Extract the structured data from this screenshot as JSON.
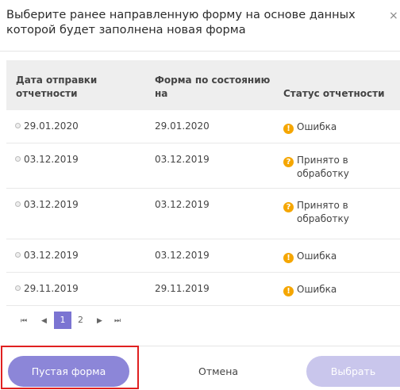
{
  "dialog": {
    "title": "Выберите ранее направленную форму на основе данных которой будет заполнена новая форма",
    "close_glyph": "×"
  },
  "table": {
    "headers": [
      "Дата отправки отчетности",
      "Форма по состоянию на",
      "Статус отчетности"
    ],
    "rows": [
      {
        "sent": "29.01.2020",
        "form_date": "29.01.2020",
        "status": "Ошибка",
        "icon": "!"
      },
      {
        "sent": "03.12.2019",
        "form_date": "03.12.2019",
        "status": "Принято в обработку",
        "icon": "?"
      },
      {
        "sent": "03.12.2019",
        "form_date": "03.12.2019",
        "status": "Принято в обработку",
        "icon": "?"
      },
      {
        "sent": "03.12.2019",
        "form_date": "03.12.2019",
        "status": "Ошибка",
        "icon": "!"
      },
      {
        "sent": "29.11.2019",
        "form_date": "29.11.2019",
        "status": "Ошибка",
        "icon": "!"
      }
    ]
  },
  "pager": {
    "first": "⏮",
    "prev": "◀",
    "pages": [
      "1",
      "2"
    ],
    "next": "▶",
    "last": "⏭"
  },
  "footer": {
    "empty_form": "Пустая форма",
    "cancel": "Отмена",
    "select": "Выбрать"
  },
  "colors": {
    "accent": "#7b74d2",
    "status_warn": "#f5a600",
    "highlight": "#e02020"
  }
}
